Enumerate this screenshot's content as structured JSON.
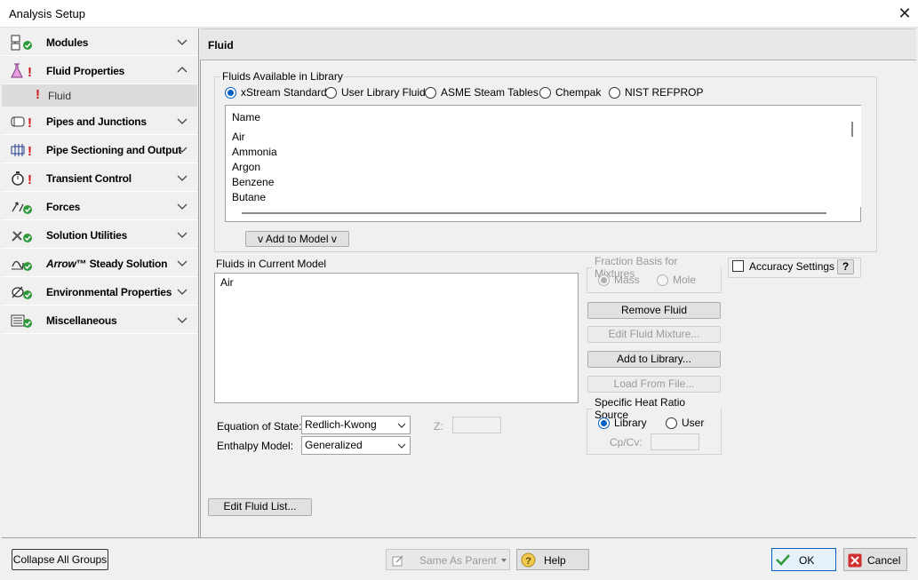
{
  "window": {
    "title": "Analysis Setup"
  },
  "sidebar": {
    "groups": [
      {
        "label": "Modules",
        "icon": "modules-icon",
        "status": "ok"
      },
      {
        "label": "Fluid Properties",
        "icon": "flask-icon",
        "status": "error",
        "expanded": true
      },
      {
        "label": "Pipes and Junctions",
        "icon": "pipe-icon",
        "status": "error"
      },
      {
        "label": "Pipe Sectioning and Output",
        "icon": "grid-pipe-icon",
        "status": "error"
      },
      {
        "label": "Transient Control",
        "icon": "stopwatch-icon",
        "status": "error"
      },
      {
        "label": "Forces",
        "icon": "forces-icon",
        "status": "ok"
      },
      {
        "label": "Solution Utilities",
        "icon": "tools-icon",
        "status": "ok"
      },
      {
        "label_brand": "Arrow",
        "label_tm": "™",
        "label": "Steady Solution",
        "icon": "steady-solution-icon",
        "status": "ok"
      },
      {
        "label": "Environmental Properties",
        "icon": "environment-icon",
        "status": "ok"
      },
      {
        "label": "Miscellaneous",
        "icon": "misc-icon",
        "status": "ok"
      }
    ],
    "sub_item": {
      "label": "Fluid",
      "status": "error"
    }
  },
  "panel": {
    "title": "Fluid",
    "library": {
      "legend": "Fluids Available in Library",
      "sources": [
        "xStream Standard",
        "User Library Fluid",
        "ASME Steam Tables",
        "Chempak",
        "NIST REFPROP"
      ],
      "selected_source": "xStream Standard",
      "column_header": "Name",
      "fluids": [
        "Air",
        "Ammonia",
        "Argon",
        "Benzene",
        "Butane"
      ],
      "add_button": "v  Add to Model  v"
    },
    "current_model": {
      "label": "Fluids in Current Model",
      "fluids": [
        "Air"
      ]
    },
    "fraction_basis": {
      "legend": "Fraction Basis for Mixtures",
      "options": [
        "Mass",
        "Mole"
      ],
      "selected": "Mass"
    },
    "buttons": {
      "remove": "Remove Fluid",
      "edit_mixture": "Edit Fluid Mixture...",
      "add_library": "Add to Library...",
      "load_file": "Load From File...",
      "edit_list": "Edit Fluid List...",
      "help_q": "?"
    },
    "accuracy": {
      "label": "Accuracy Settings",
      "checked": false
    },
    "equation_of_state": {
      "label": "Equation of State:",
      "value": "Redlich-Kwong"
    },
    "enthalpy_model": {
      "label": "Enthalpy Model:",
      "value": "Generalized"
    },
    "z_label": "Z:",
    "specific_heat": {
      "legend": "Specific Heat Ratio Source",
      "options": [
        "Library",
        "User"
      ],
      "selected": "Library",
      "cpcv_label": "Cp/Cv:"
    }
  },
  "footer": {
    "collapse": "Collapse All Groups",
    "same_as_parent": "Same As Parent",
    "help": "Help",
    "ok": "OK",
    "cancel": "Cancel"
  },
  "colors": {
    "error": "#d01818",
    "ok": "#2e9a3c",
    "accent": "#0060c0"
  }
}
